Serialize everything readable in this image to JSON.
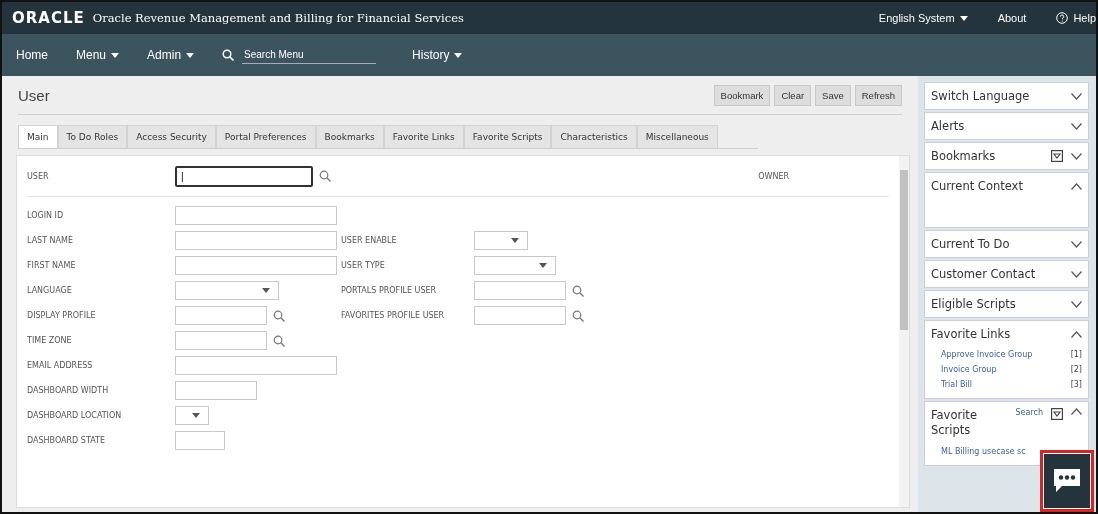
{
  "header": {
    "logo": "ORACLE",
    "product": "Oracle Revenue Management and Billing for Financial Services",
    "links": [
      {
        "label": "English System",
        "dropdown": true
      },
      {
        "label": "About",
        "dropdown": false
      },
      {
        "label": "Help",
        "dropdown": false,
        "help": true
      }
    ]
  },
  "nav": {
    "items": [
      {
        "label": "Home",
        "dropdown": false
      },
      {
        "label": "Menu",
        "dropdown": true
      },
      {
        "label": "Admin",
        "dropdown": true
      }
    ],
    "search": {
      "placeholder": "Search Menu"
    },
    "history": {
      "label": "History",
      "dropdown": true
    }
  },
  "page": {
    "title": "User",
    "buttons": [
      "Bookmark",
      "Clear",
      "Save",
      "Refresh"
    ]
  },
  "tabs": [
    {
      "label": "Main",
      "selected": true
    },
    {
      "label": "To Do Roles",
      "selected": false
    },
    {
      "label": "Access Security",
      "selected": false
    },
    {
      "label": "Portal Preferences",
      "selected": false
    },
    {
      "label": "Bookmarks",
      "selected": false
    },
    {
      "label": "Favorite Links",
      "selected": false
    },
    {
      "label": "Favorite Scripts",
      "selected": false
    },
    {
      "label": "Characteristics",
      "selected": false
    },
    {
      "label": "Miscellaneous",
      "selected": false
    }
  ],
  "key_row": {
    "label": "USER",
    "kind": "lookup",
    "focused": true,
    "value": "|",
    "owner_label": "OWNER"
  },
  "rows": [
    {
      "left": {
        "label": "LOGIN ID",
        "kind": "text"
      }
    },
    {
      "left": {
        "label": "LAST NAME",
        "kind": "text"
      },
      "right": {
        "label": "USER ENABLE",
        "kind": "small-select"
      }
    },
    {
      "left": {
        "label": "FIRST NAME",
        "kind": "text"
      },
      "right": {
        "label": "USER TYPE",
        "kind": "select"
      }
    },
    {
      "left": {
        "label": "LANGUAGE",
        "kind": "select"
      },
      "right": {
        "label": "PORTALS PROFILE USER",
        "kind": "lookup"
      }
    },
    {
      "left": {
        "label": "DISPLAY PROFILE",
        "kind": "lookup"
      },
      "right": {
        "label": "FAVORITES PROFILE USER",
        "kind": "lookup"
      }
    },
    {
      "left": {
        "label": "TIME ZONE",
        "kind": "lookup"
      }
    },
    {
      "left": {
        "label": "EMAIL ADDRESS",
        "kind": "text"
      }
    },
    {
      "left": {
        "label": "DASHBOARD WIDTH",
        "kind": "short-text"
      }
    },
    {
      "left": {
        "label": "DASHBOARD LOCATION",
        "kind": "tiny-select"
      }
    },
    {
      "left": {
        "label": "DASHBOARD STATE",
        "kind": "tiny-text"
      }
    }
  ],
  "sidebar": [
    {
      "title": "Switch Language",
      "expanded": false
    },
    {
      "title": "Alerts",
      "expanded": false
    },
    {
      "title": "Bookmarks",
      "expanded": false,
      "filter": true
    },
    {
      "title": "Current Context",
      "expanded": true
    },
    {
      "title": "Current To Do",
      "expanded": false
    },
    {
      "title": "Customer Contact",
      "expanded": false
    },
    {
      "title": "Eligible Scripts",
      "expanded": false
    },
    {
      "title": "Favorite Links",
      "expanded": true,
      "links": [
        {
          "label": "Approve Invoice Group",
          "index": "[1]"
        },
        {
          "label": "Invoice Group",
          "index": "[2]"
        },
        {
          "label": "Trial Bill",
          "index": "[3]"
        }
      ]
    },
    {
      "title": "Favorite Scripts",
      "expanded": true,
      "filter": true,
      "search": "Search",
      "links": [
        {
          "label": "ML Billing usecase sc"
        }
      ]
    }
  ]
}
